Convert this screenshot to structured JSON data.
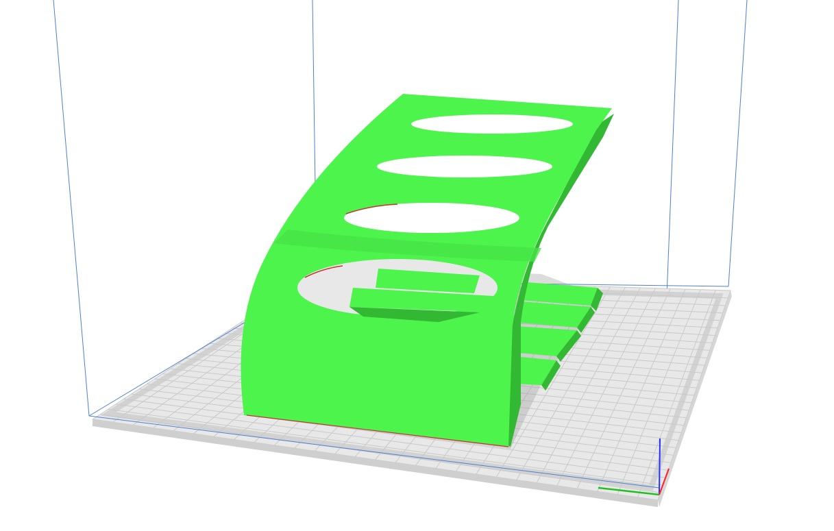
{
  "viewport": {
    "view": "3d-slicer-preview",
    "background_color": "#ffffff",
    "build_volume_edge_color": "#4a7fd6",
    "plate_color": "#e6e6e6",
    "plate_grid_color": "#c8c8c8",
    "model_color": "#4cf44c",
    "model_shade_color": "#3bd43b",
    "model_dark_color": "#2fa52f",
    "axis_colors": {
      "x": "#ff2020",
      "y": "#20c020",
      "z": "#2030ff"
    }
  }
}
